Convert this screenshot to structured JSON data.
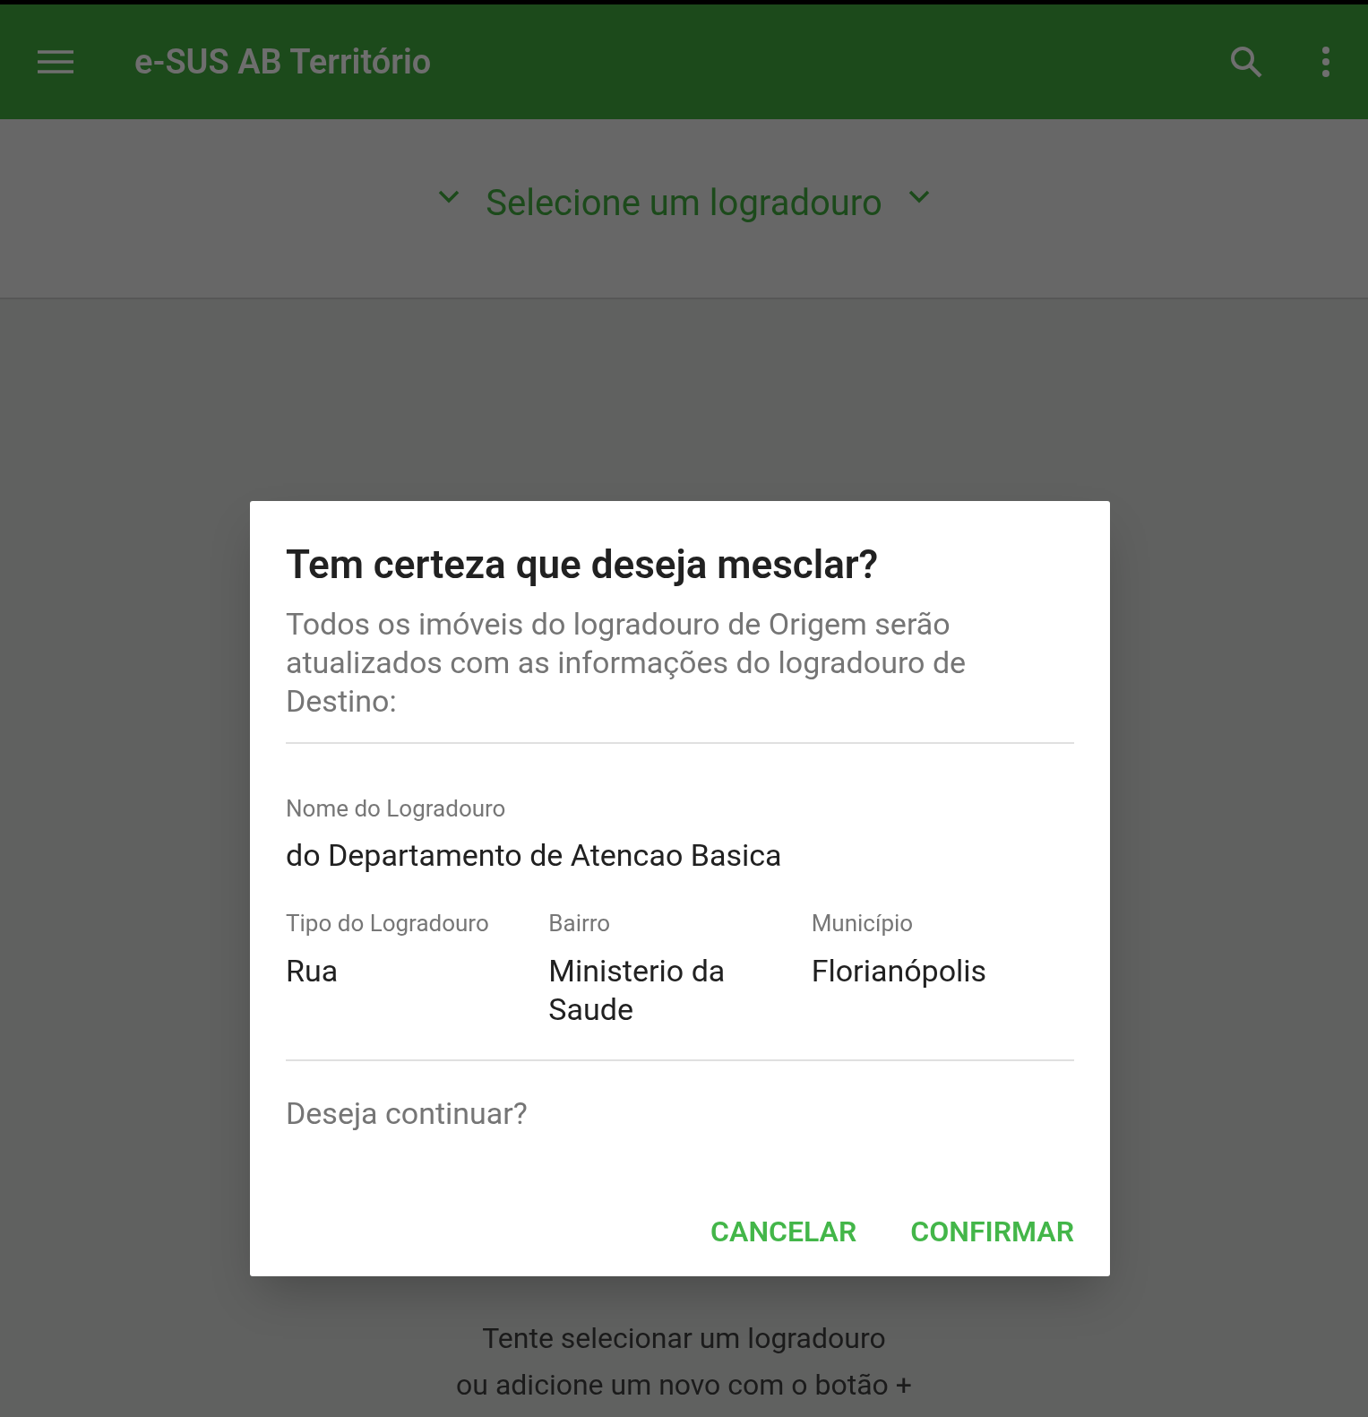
{
  "app_bar": {
    "title": "e-SUS AB Território"
  },
  "selector": {
    "label": "Selecione um logradouro"
  },
  "empty_state": {
    "lines": [
      "Tente selecionar um logradouro",
      "ou adicione um novo com o botão +"
    ]
  },
  "dialog": {
    "title": "Tem certeza que deseja mesclar?",
    "message": "Todos os imóveis do logradouro de Origem serão atualizados com as informações do logradouro de Destino:",
    "name_field": {
      "label": "Nome do Logradouro",
      "value": "do Departamento de Atencao Basica"
    },
    "fields": [
      {
        "label": "Tipo do Logradouro",
        "value": "Rua"
      },
      {
        "label": "Bairro",
        "value": "Ministerio da Saude"
      },
      {
        "label": "Município",
        "value": "Florianópolis"
      }
    ],
    "question": "Deseja continuar?",
    "buttons": [
      "CANCELAR",
      "CONFIRMAR"
    ]
  }
}
